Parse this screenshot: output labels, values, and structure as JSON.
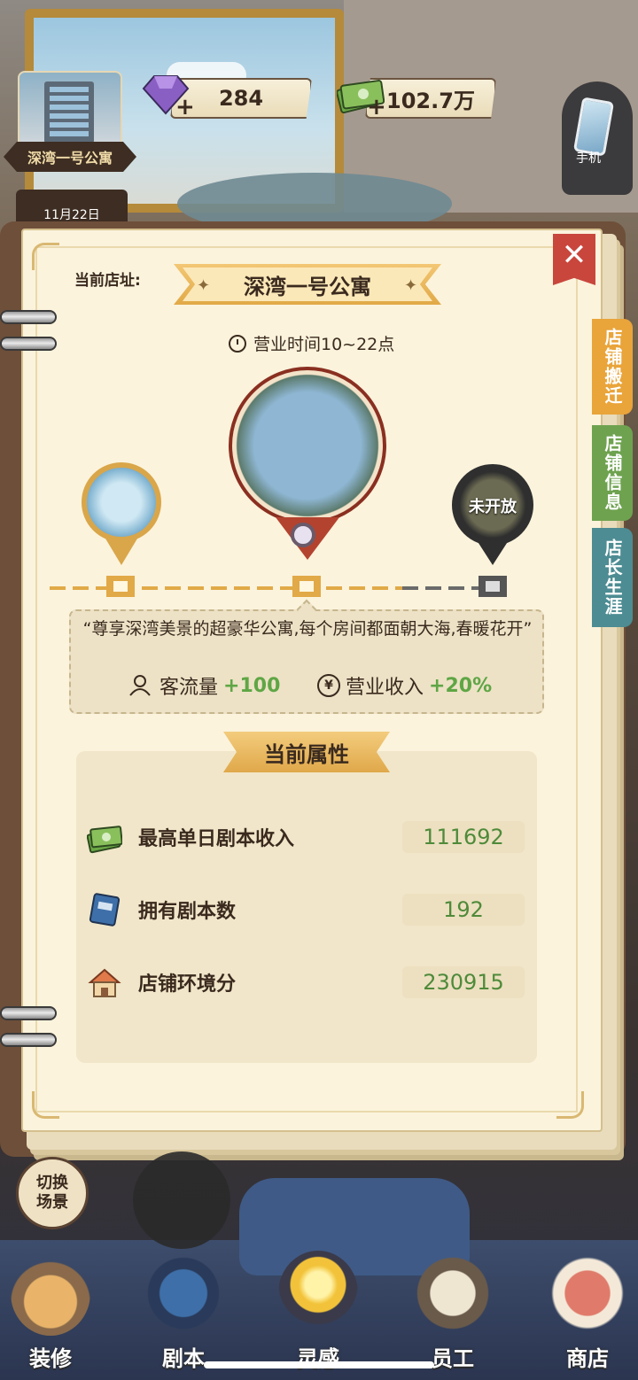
{
  "top_bar": {
    "current_shop_thumb_label": "深湾一号公寓",
    "date_label": "11月22日",
    "gems": "284",
    "money": "102.7万",
    "phone_label": "手机"
  },
  "notebook": {
    "address_label": "当前店址:",
    "shop_name": "深湾一号公寓",
    "business_hours": "营业时间10~22点",
    "locked_label": "未开放",
    "description": "“尊享深湾美景的超豪华公寓,每个房间都面朝大海,春暖花开”",
    "bonuses": [
      {
        "icon": "customers-icon",
        "label": "客流量",
        "value": "+100"
      },
      {
        "icon": "yen-icon",
        "label": "营业收入",
        "value": "+20%"
      }
    ],
    "properties_title": "当前属性",
    "properties": [
      {
        "icon": "money-stack-icon",
        "label": "最高单日剧本收入",
        "value": "111692"
      },
      {
        "icon": "script-book-icon",
        "label": "拥有剧本数",
        "value": "192"
      },
      {
        "icon": "shop-house-icon",
        "label": "店铺环境分",
        "value": "230915"
      }
    ],
    "close_glyph": "✕"
  },
  "side_tabs": [
    {
      "label": "店铺搬迁",
      "color": "#e9a43a"
    },
    {
      "label": "店铺信息",
      "color": "#6ea24f"
    },
    {
      "label": "店长生涯",
      "color": "#4d8c93"
    }
  ],
  "scene_switch": {
    "line1": "切换",
    "line2": "场景"
  },
  "bottom_nav": [
    {
      "label": "装修",
      "icon": "house-icon"
    },
    {
      "label": "剧本",
      "icon": "script-book-icon"
    },
    {
      "label": "灵感",
      "icon": "lightbulb-icon"
    },
    {
      "label": "员工",
      "icon": "id-card-icon"
    },
    {
      "label": "商店",
      "icon": "shop-icon"
    }
  ],
  "colors": {
    "accent_gold": "#e1a947",
    "positive_green": "#5fa645",
    "close_red": "#c9463d"
  }
}
